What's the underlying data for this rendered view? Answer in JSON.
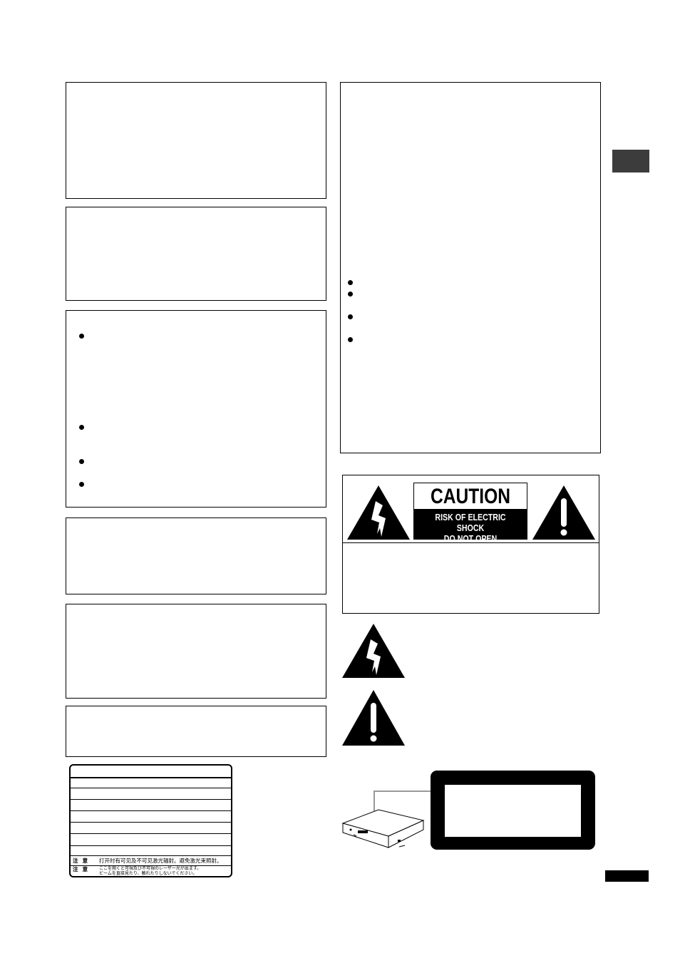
{
  "page": {
    "side_tab_color": "#3c3c3c",
    "page_tab_color": "#000000"
  },
  "left_column": {
    "boxes": [
      {
        "id": "notice-1",
        "bullets": 0
      },
      {
        "id": "notice-2",
        "bullets": 0
      },
      {
        "id": "notice-3",
        "bullets": 4
      },
      {
        "id": "notice-4",
        "bullets": 0
      },
      {
        "id": "notice-5",
        "bullets": 0
      },
      {
        "id": "notice-6",
        "bullets": 0
      }
    ]
  },
  "right_column": {
    "boxes": [
      {
        "id": "notice-7",
        "bullets": 4
      }
    ]
  },
  "caution_panel": {
    "title": "CAUTION",
    "line1": "RISK OF ELECTRIC SHOCK",
    "line2": "DO NOT OPEN",
    "left_icon": "lightning-triangle-icon",
    "right_icon": "exclamation-triangle-icon"
  },
  "symbols": [
    {
      "icon": "lightning-triangle-icon"
    },
    {
      "icon": "exclamation-triangle-icon"
    }
  ],
  "laser_label": {
    "rows": [
      {
        "key": "注 意",
        "text": "打开时有可见及不可见激光辐射。避免激光束照射。"
      },
      {
        "key": "注 意",
        "text_line1": "ここを開くと可視及び不可視のレーザー光が出ます。",
        "text_line2": "ビームを直接見たり、触れたりしないでください。"
      }
    ]
  },
  "product_illustration": {
    "icon": "player-device-icon",
    "label_icon": "label-frame-icon"
  }
}
